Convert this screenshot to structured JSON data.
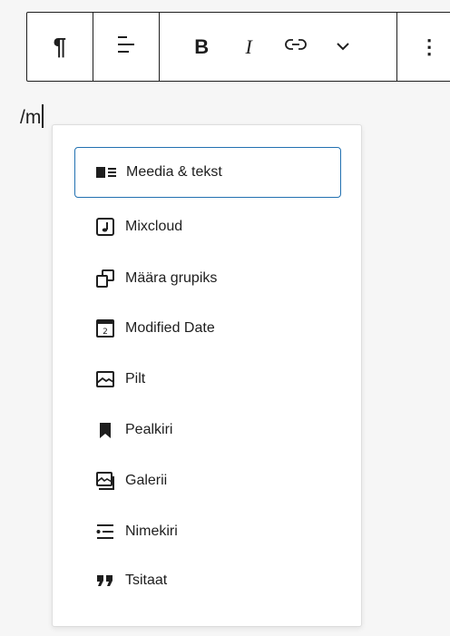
{
  "toolbar": {
    "buttons": [
      {
        "name": "paragraph-icon",
        "glyph": "¶"
      },
      {
        "name": "align-icon"
      },
      {
        "name": "bold-button",
        "glyph": "B"
      },
      {
        "name": "italic-button",
        "glyph": "I"
      },
      {
        "name": "link-icon"
      },
      {
        "name": "chevron-down-icon"
      },
      {
        "name": "more-options-icon",
        "glyph": "⋮"
      }
    ]
  },
  "editor": {
    "typed_text": "/m"
  },
  "menu": {
    "items": [
      {
        "label": "Meedia & tekst",
        "icon": "media-text-icon",
        "active": true
      },
      {
        "label": "Mixcloud",
        "icon": "mixcloud-icon"
      },
      {
        "label": "Määra grupiks",
        "icon": "group-icon"
      },
      {
        "label": "Modified Date",
        "icon": "calendar-icon"
      },
      {
        "label": "Pilt",
        "icon": "image-icon"
      },
      {
        "label": "Pealkiri",
        "icon": "bookmark-icon"
      },
      {
        "label": "Galerii",
        "icon": "gallery-icon"
      },
      {
        "label": "Nimekiri",
        "icon": "list-icon"
      },
      {
        "label": "Tsitaat",
        "icon": "quote-icon"
      }
    ]
  },
  "colors": {
    "accent": "#2271b1",
    "text": "#1e1e1e",
    "background": "#f6f6f6"
  }
}
